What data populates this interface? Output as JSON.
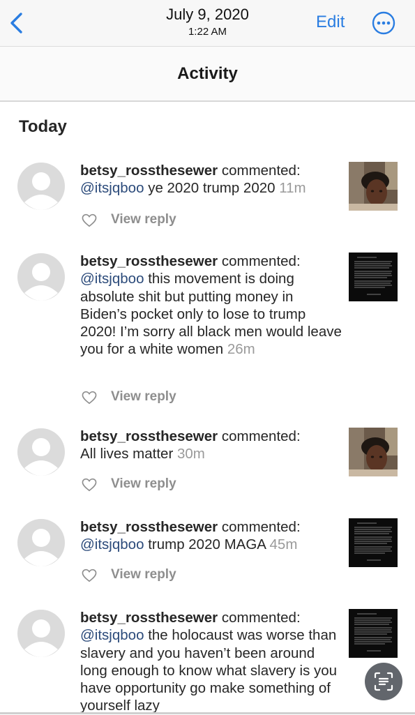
{
  "photos_header": {
    "date": "July 9, 2020",
    "time": "1:22 AM",
    "edit_label": "Edit",
    "back_icon": "chevron-left-icon",
    "more_icon": "ellipsis-circle-icon",
    "accent_color": "#2a7de1"
  },
  "activity": {
    "title": "Activity",
    "section": "Today",
    "items": [
      {
        "username": "betsy_rossthesewer",
        "action": "commented:",
        "mention": "@itsjqboo",
        "body": "ye 2020 trump 2020",
        "time": "11m",
        "reply_label": "View reply",
        "thumbnail": "portrait-photo"
      },
      {
        "username": "betsy_rossthesewer",
        "action": "commented:",
        "mention": "@itsjqboo",
        "body": "this movement is doing absolute shit but putting money in Biden’s pocket only to lose to trump 2020! I’m sorry all black men would leave you for a white women",
        "time": "26m",
        "reply_label": "View reply",
        "thumbnail": "dark-text-post"
      },
      {
        "username": "betsy_rossthesewer",
        "action": "commented:",
        "mention": "",
        "body": "All lives matter",
        "time": "30m",
        "reply_label": "View reply",
        "thumbnail": "portrait-photo"
      },
      {
        "username": "betsy_rossthesewer",
        "action": "commented:",
        "mention": "@itsjqboo",
        "body": "trump 2020 MAGA",
        "time": "45m",
        "reply_label": "View reply",
        "thumbnail": "dark-text-post"
      },
      {
        "username": "betsy_rossthesewer",
        "action": "commented:",
        "mention": "@itsjqboo",
        "body": "the holocaust was worse than slavery and you haven’t been around long enough to know what slavery is you have opportunity go make something of yourself lazy",
        "time": "",
        "reply_label": "",
        "thumbnail": "dark-text-post"
      }
    ]
  },
  "live_text_icon": "live-text-icon"
}
